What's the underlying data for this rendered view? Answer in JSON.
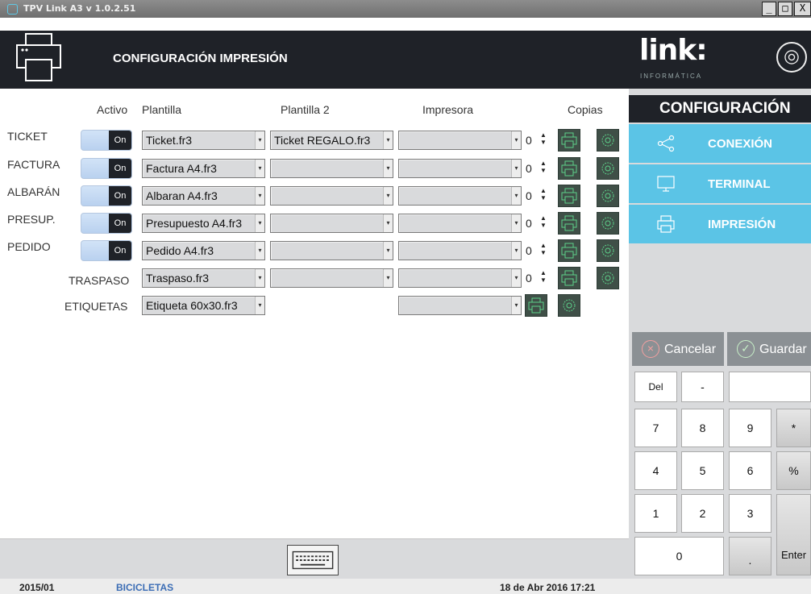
{
  "window": {
    "title": "TPV Link A3 v 1.0.2.51",
    "controls": [
      "_",
      "□",
      "X"
    ]
  },
  "header": {
    "title": "CONFIGURACIÓN IMPRESIÓN"
  },
  "brand": {
    "logo": "link:",
    "subtitle": "INFORMÁTICA"
  },
  "side": {
    "title": "CONFIGURACIÓN",
    "menu": [
      {
        "label": "CONEXIÓN",
        "icon": "share-icon"
      },
      {
        "label": "TERMINAL",
        "icon": "monitor-icon"
      },
      {
        "label": "IMPRESIÓN",
        "icon": "printer-icon"
      }
    ],
    "cancel_label": "Cancelar",
    "save_label": "Guardar"
  },
  "table": {
    "headers": {
      "active": "Activo",
      "template": "Plantilla",
      "template2": "Plantilla 2",
      "printer": "Impresora",
      "copies": "Copias"
    },
    "rows": [
      {
        "label": "TICKET",
        "toggle": "On",
        "template": "Ticket.fr3",
        "template2": "Ticket REGALO.fr3",
        "printer": "",
        "copies": "0"
      },
      {
        "label": "FACTURA",
        "toggle": "On",
        "template": "Factura A4.fr3",
        "template2": "",
        "printer": "",
        "copies": "0"
      },
      {
        "label": "ALBARÁN",
        "toggle": "On",
        "template": "Albaran A4.fr3",
        "template2": "",
        "printer": "",
        "copies": "0"
      },
      {
        "label": "PRESUP.",
        "toggle": "On",
        "template": "Presupuesto A4.fr3",
        "template2": "",
        "printer": "",
        "copies": "0"
      },
      {
        "label": "PEDIDO",
        "toggle": "On",
        "template": "Pedido A4.fr3",
        "template2": "",
        "printer": "",
        "copies": "0"
      },
      {
        "label": "TRASPASO",
        "template": "Traspaso.fr3",
        "template2": "",
        "printer": "",
        "copies": "0"
      },
      {
        "label": "ETIQUETAS",
        "template": "Etiqueta 60x30.fr3",
        "printer": ""
      }
    ]
  },
  "keypad": {
    "row0": [
      "Del",
      "-",
      ""
    ],
    "row1": [
      "7",
      "8",
      "9",
      "*"
    ],
    "row2": [
      "4",
      "5",
      "6",
      "%"
    ],
    "row3": [
      "1",
      "2",
      "3"
    ],
    "enter": "Enter",
    "zero": "0",
    "dot": "."
  },
  "status": {
    "period": "2015/01",
    "company": "BICICLETAS",
    "datetime": "18 de Abr 2016 17:21"
  },
  "colors": {
    "dark": "#1f2228",
    "accent": "#5bc4e6",
    "toggle": "#c7dbf3",
    "icon_bg": "#3f4f47",
    "icon_fg": "#5dd18a"
  }
}
